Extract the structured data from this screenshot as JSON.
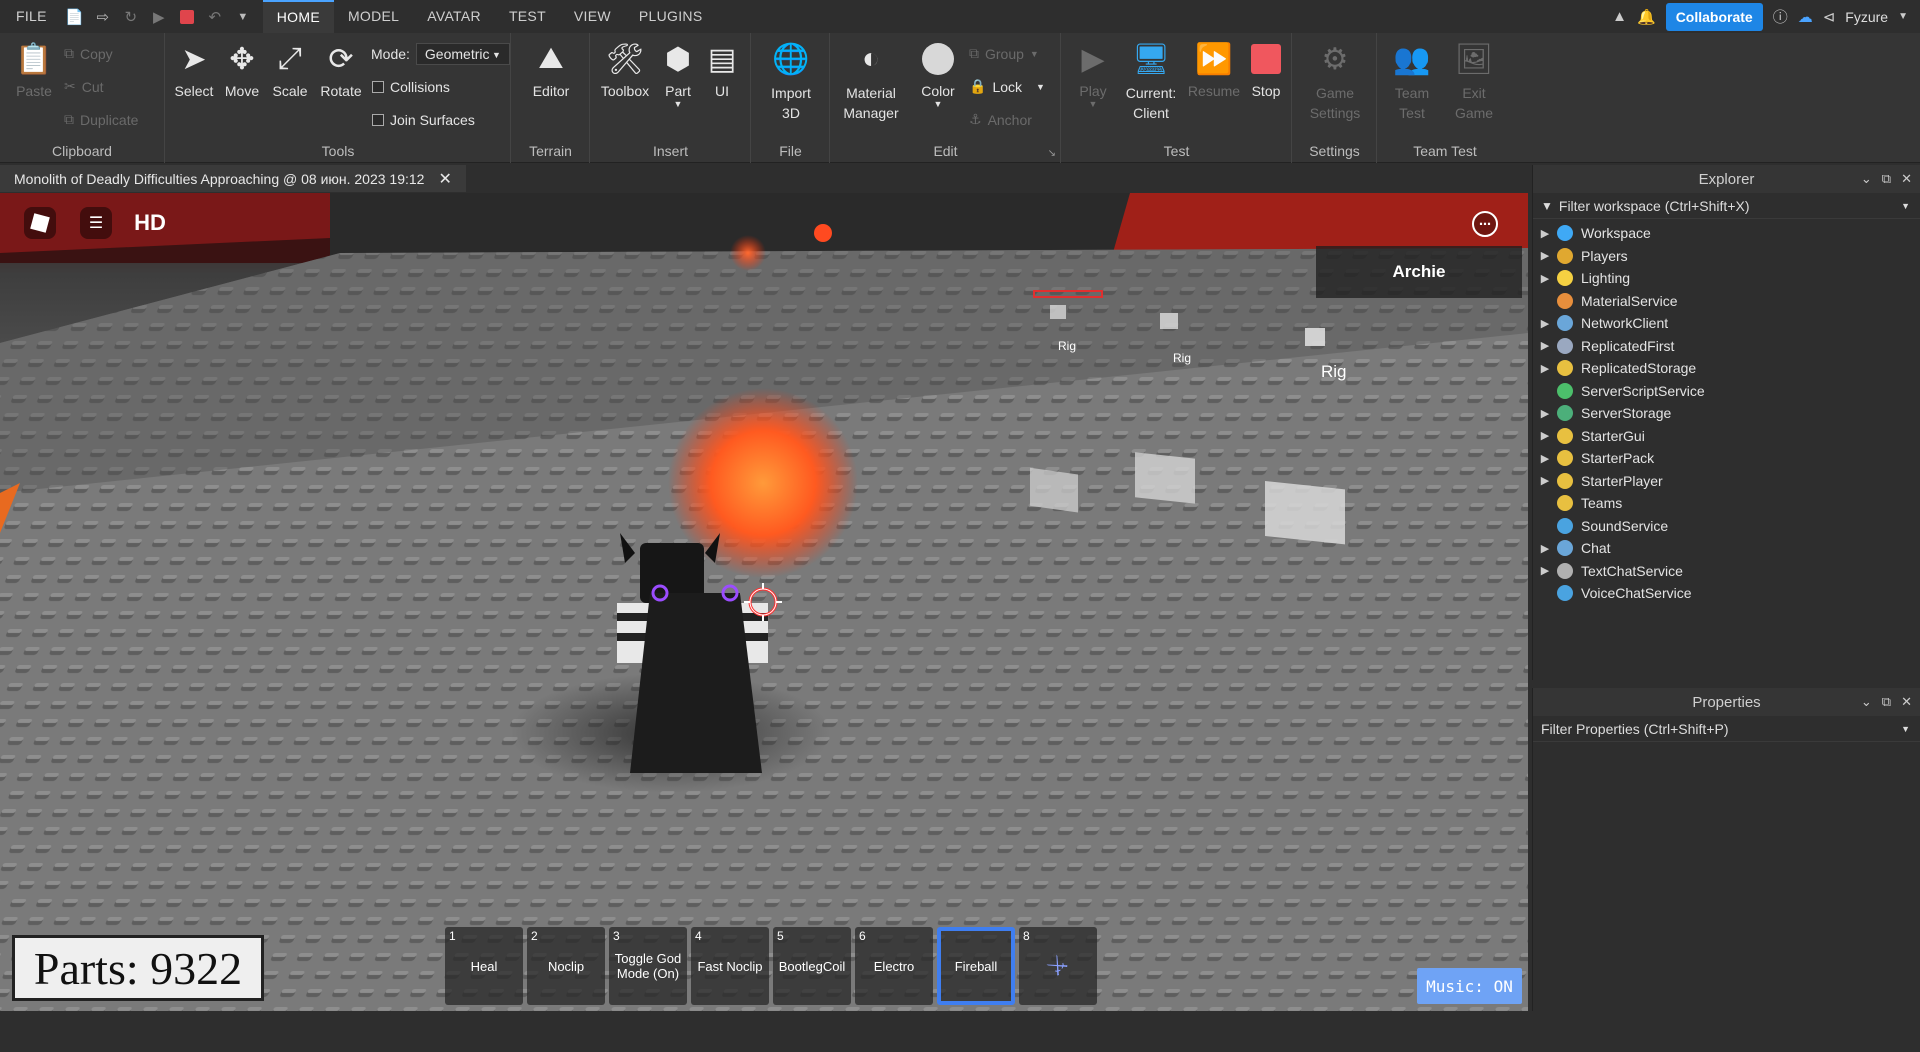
{
  "menu": {
    "file": "FILE",
    "tabs": [
      "HOME",
      "MODEL",
      "AVATAR",
      "TEST",
      "VIEW",
      "PLUGINS"
    ],
    "active_tab": "HOME",
    "collaborate": "Collaborate",
    "user": "Fyzure"
  },
  "ribbon": {
    "clipboard": {
      "label": "Clipboard",
      "paste": "Paste",
      "copy": "Copy",
      "cut": "Cut",
      "duplicate": "Duplicate"
    },
    "tools": {
      "label": "Tools",
      "select": "Select",
      "move": "Move",
      "scale": "Scale",
      "rotate": "Rotate",
      "mode_label": "Mode:",
      "mode_value": "Geometric",
      "collisions": "Collisions",
      "join_surfaces": "Join Surfaces"
    },
    "terrain": {
      "label": "Terrain",
      "editor": "Editor"
    },
    "insert": {
      "label": "Insert",
      "toolbox": "Toolbox",
      "part": "Part",
      "ui": "UI"
    },
    "file": {
      "label": "File",
      "import3d": "Import 3D"
    },
    "edit": {
      "label": "Edit",
      "material_manager": "Material Manager",
      "color": "Color",
      "group": "Group",
      "lock": "Lock",
      "anchor": "Anchor"
    },
    "test": {
      "label": "Test",
      "play": "Play",
      "current_client": "Current: Client",
      "resume": "Resume",
      "stop": "Stop"
    },
    "settings": {
      "label": "Settings",
      "game_settings": "Game Settings"
    },
    "team_test": {
      "label": "Team Test",
      "team_test": "Team Test",
      "exit_game": "Exit Game"
    }
  },
  "document_tab": {
    "title": "Monolith of Deadly Difficulties Approaching @ 08 июн. 2023 19:12"
  },
  "viewport": {
    "hd_label": "HD",
    "player_name": "Archie",
    "rig_labels": [
      "Rig",
      "Rig",
      "Rig"
    ],
    "parts_text": "Parts: 9322",
    "music": "Music: ON",
    "hotbar": [
      {
        "num": "1",
        "label": "Heal"
      },
      {
        "num": "2",
        "label": "Noclip"
      },
      {
        "num": "3",
        "label": "Toggle God Mode (On)"
      },
      {
        "num": "4",
        "label": "Fast Noclip"
      },
      {
        "num": "5",
        "label": "BootlegCoil"
      },
      {
        "num": "6",
        "label": "Electro"
      },
      {
        "num": "",
        "label": "Fireball"
      },
      {
        "num": "8",
        "label": ""
      }
    ]
  },
  "explorer": {
    "title": "Explorer",
    "filter": "Filter workspace (Ctrl+Shift+X)",
    "items": [
      {
        "name": "Workspace",
        "expandable": true,
        "icon_color": "#3fa9f5"
      },
      {
        "name": "Players",
        "expandable": true,
        "icon_color": "#e0a830"
      },
      {
        "name": "Lighting",
        "expandable": true,
        "icon_color": "#f5d142"
      },
      {
        "name": "MaterialService",
        "expandable": false,
        "icon_color": "#e88f3c"
      },
      {
        "name": "NetworkClient",
        "expandable": true,
        "icon_color": "#6aa6d9"
      },
      {
        "name": "ReplicatedFirst",
        "expandable": true,
        "icon_color": "#9aa8c0"
      },
      {
        "name": "ReplicatedStorage",
        "expandable": true,
        "icon_color": "#e8c040"
      },
      {
        "name": "ServerScriptService",
        "expandable": false,
        "icon_color": "#4cbf6b"
      },
      {
        "name": "ServerStorage",
        "expandable": true,
        "icon_color": "#4caf7a"
      },
      {
        "name": "StarterGui",
        "expandable": true,
        "icon_color": "#e8c040"
      },
      {
        "name": "StarterPack",
        "expandable": true,
        "icon_color": "#e8c040"
      },
      {
        "name": "StarterPlayer",
        "expandable": true,
        "icon_color": "#e8c040"
      },
      {
        "name": "Teams",
        "expandable": false,
        "icon_color": "#e8c040"
      },
      {
        "name": "SoundService",
        "expandable": false,
        "icon_color": "#4aa3e0"
      },
      {
        "name": "Chat",
        "expandable": true,
        "icon_color": "#6aa6d9"
      },
      {
        "name": "TextChatService",
        "expandable": true,
        "icon_color": "#b0b0b0"
      },
      {
        "name": "VoiceChatService",
        "expandable": false,
        "icon_color": "#4aa3e0"
      }
    ]
  },
  "properties": {
    "title": "Properties",
    "filter": "Filter Properties (Ctrl+Shift+P)"
  }
}
